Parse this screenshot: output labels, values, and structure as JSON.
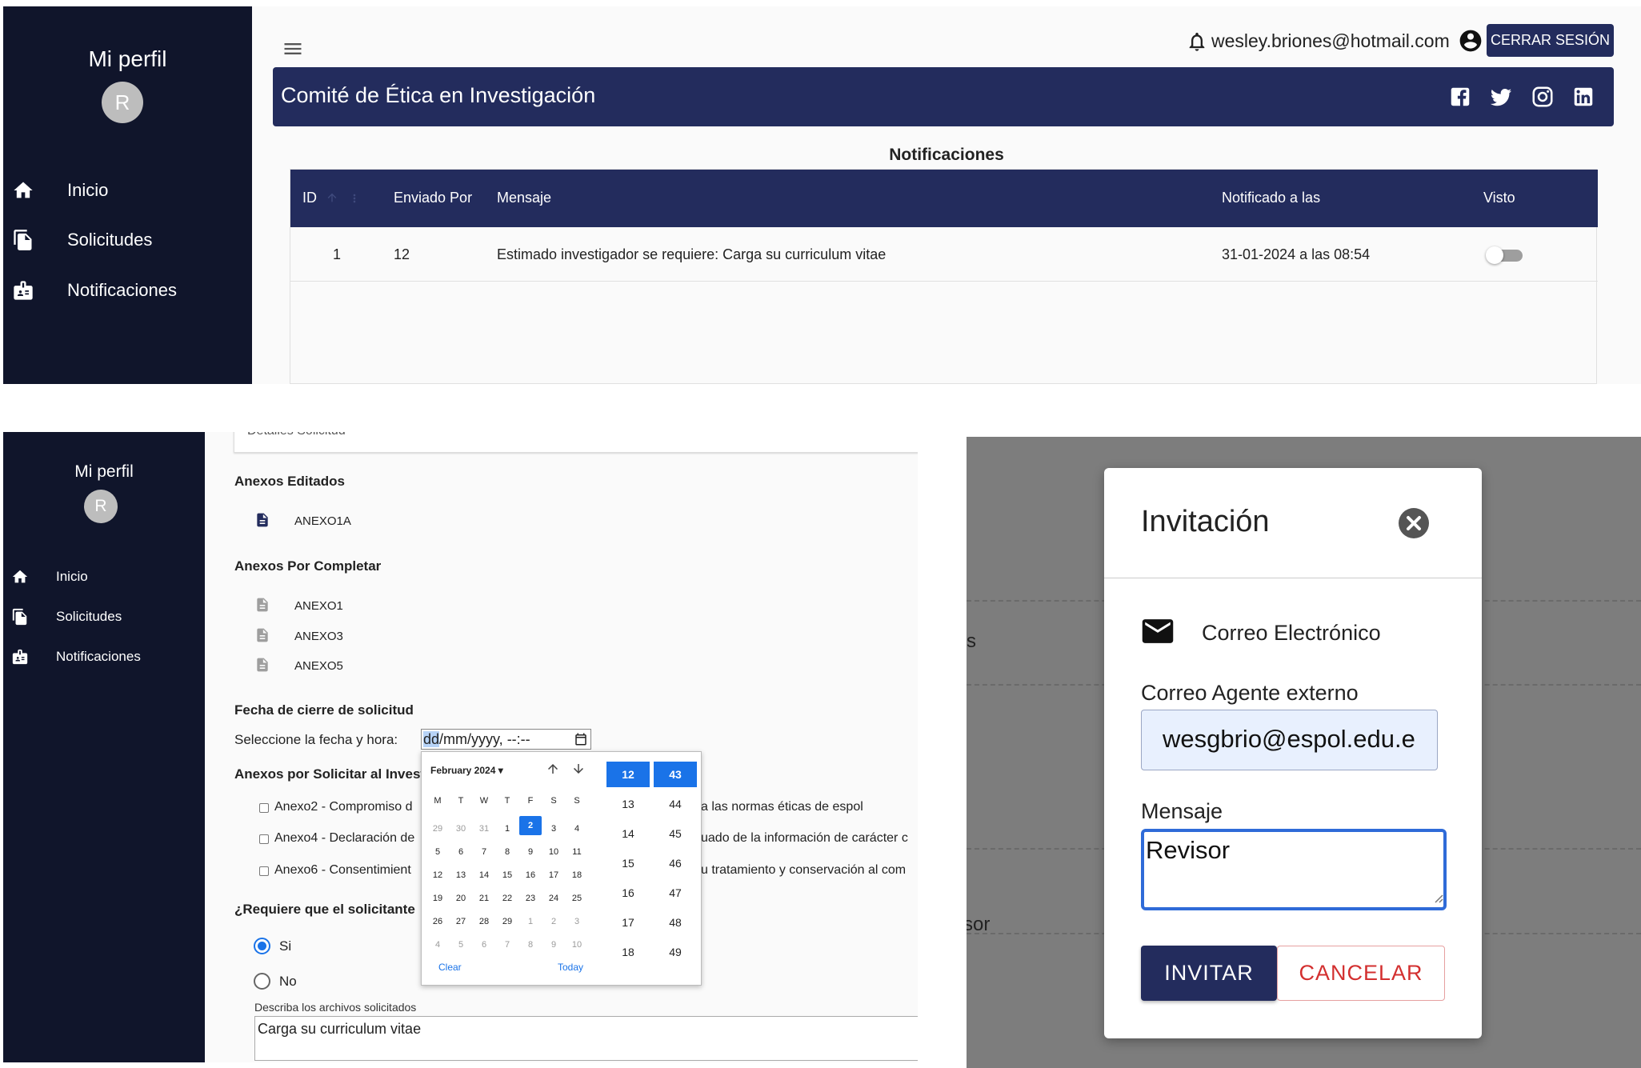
{
  "sidebar": {
    "profile_title": "Mi perfil",
    "avatar_initial": "R",
    "items": [
      {
        "label": "Inicio",
        "icon": "home-icon"
      },
      {
        "label": "Solicitudes",
        "icon": "documents-icon"
      },
      {
        "label": "Notificaciones",
        "icon": "badge-icon"
      }
    ]
  },
  "topbar": {
    "user_email": "wesley.briones@hotmail.com",
    "logout_label": "CERRAR SESIÓN"
  },
  "banner": {
    "title": "Comité de Ética en Investigación",
    "social_icons": [
      "facebook-icon",
      "twitter-icon",
      "instagram-icon",
      "linkedin-icon"
    ]
  },
  "notifications": {
    "heading": "Notificaciones",
    "columns": [
      "ID",
      "Enviado Por",
      "Mensaje",
      "Notificado a las",
      "Visto"
    ],
    "rows": [
      {
        "id": "1",
        "sender": "12",
        "message": "Estimado investigador se requiere: Carga su curriculum vitae",
        "time": "31-01-2024 a las 08:54",
        "seen": false
      }
    ]
  },
  "form": {
    "details_cut_label": "Detalles Solicitud",
    "edited_annexes_heading": "Anexos Editados",
    "edited_annexes": [
      "ANEXO1A"
    ],
    "pending_annexes_heading": "Anexos Por Completar",
    "pending_annexes": [
      "ANEXO1",
      "ANEXO3",
      "ANEXO5"
    ],
    "close_date_heading": "Fecha de cierre de solicitud",
    "date_prompt": "Seleccione la fecha y hora:",
    "date_placeholder_highlight": "dd",
    "date_placeholder_rest": "/mm/yyyy, --:--",
    "request_heading": "Anexos por Solicitar al Invest",
    "checkbox_items": [
      {
        "left": "Anexo2 - Compromiso d",
        "right": "a las normas éticas de espol"
      },
      {
        "left": "Anexo4 - Declaración de",
        "right": "uado de la información de carácter c"
      },
      {
        "left": "Anexo6 - Consentimient",
        "right": "u tratamiento y conservación al com"
      }
    ],
    "require_question": "¿Requiere que el solicitante",
    "radio_options": [
      "Si",
      "No"
    ],
    "radio_selected": "Si",
    "describe_label": "Describa los archivos solicitados",
    "describe_value": "Carga su curriculum vitae"
  },
  "calendar": {
    "month_label": "February 2024",
    "weekdays": [
      "M",
      "T",
      "W",
      "T",
      "F",
      "S",
      "S"
    ],
    "weeks": [
      [
        "29",
        "30",
        "31",
        "1",
        "2",
        "3",
        "4"
      ],
      [
        "5",
        "6",
        "7",
        "8",
        "9",
        "10",
        "11"
      ],
      [
        "12",
        "13",
        "14",
        "15",
        "16",
        "17",
        "18"
      ],
      [
        "19",
        "20",
        "21",
        "22",
        "23",
        "24",
        "25"
      ],
      [
        "26",
        "27",
        "28",
        "29",
        "1",
        "2",
        "3"
      ],
      [
        "4",
        "5",
        "6",
        "7",
        "8",
        "9",
        "10"
      ]
    ],
    "selected_day": "2",
    "clear_label": "Clear",
    "today_label": "Today",
    "hours": [
      "12",
      "13",
      "14",
      "15",
      "16",
      "17",
      "18"
    ],
    "minutes": [
      "43",
      "44",
      "45",
      "46",
      "47",
      "48",
      "49"
    ],
    "accent": "#1a73e8"
  },
  "modal": {
    "title": "Invitación",
    "email_section_label": "Correo Electrónico",
    "email_field_label": "Correo Agente externo",
    "email_value": "wesgbrio@espol.edu.e",
    "message_label": "Mensaje",
    "message_value": "Revisor",
    "invite_label": "INVITAR",
    "cancel_label": "CANCELAR",
    "background_fragments": [
      "s",
      "sor"
    ]
  },
  "colors": {
    "navy": "#232c5d",
    "sidebar": "#10152b",
    "danger": "#d32f2f",
    "overlay": "#7d7d7d"
  }
}
